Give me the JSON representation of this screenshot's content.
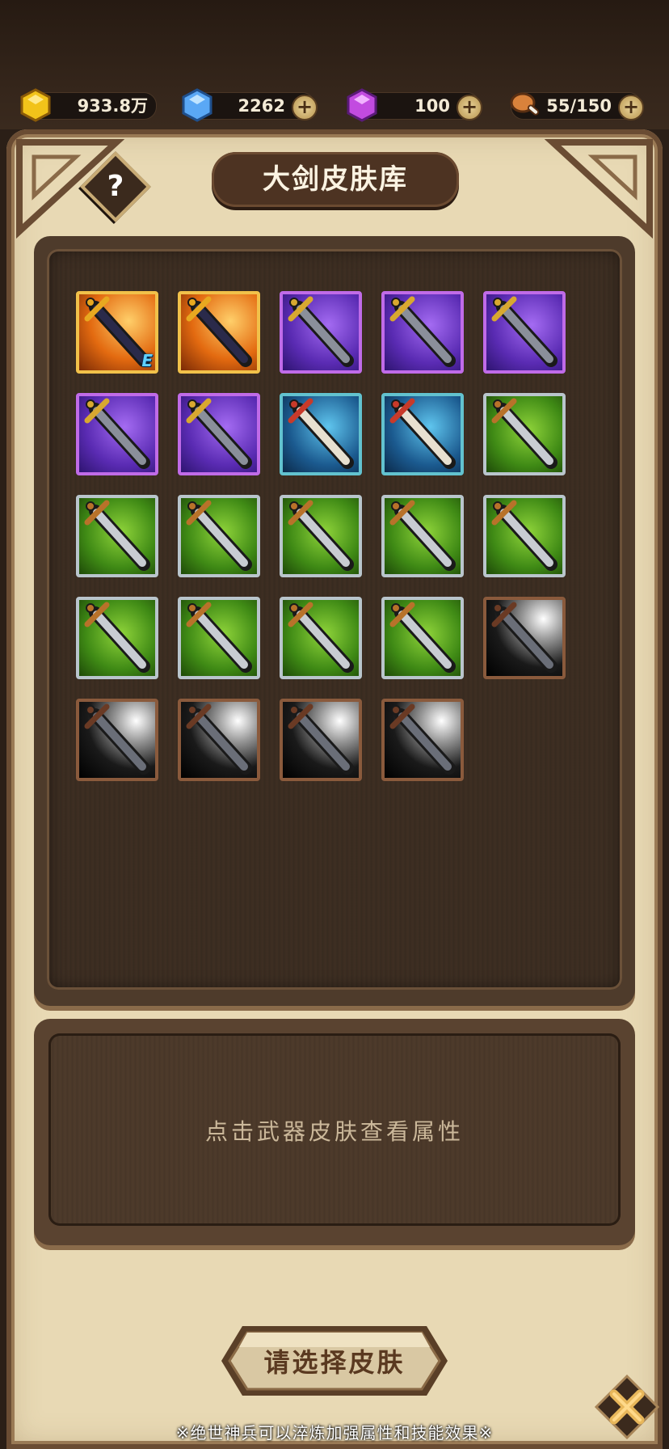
{
  "resources": {
    "gold": {
      "value": "933.8万",
      "icon": "gold-gem-icon",
      "color": "#f2c31a"
    },
    "diamond": {
      "value": "2262",
      "icon": "blue-diamond-icon",
      "color": "#5aa8f5",
      "plus": "+"
    },
    "crystal": {
      "value": "100",
      "icon": "purple-crystal-icon",
      "color": "#c24be0",
      "plus": "+"
    },
    "stamina": {
      "value": "55/150",
      "icon": "meat-drumstick-icon",
      "color": "#d9823b",
      "plus": "+"
    }
  },
  "header": {
    "title": "大剑皮肤库",
    "help_label": "?"
  },
  "skins": [
    {
      "rarity": "orange",
      "icon": "axe-greatsword-icon",
      "badge": "E"
    },
    {
      "rarity": "orange",
      "icon": "golden-greatsword-icon"
    },
    {
      "rarity": "purple",
      "icon": "dark-greatsword-icon"
    },
    {
      "rarity": "purple",
      "icon": "crimson-blade-icon"
    },
    {
      "rarity": "purple",
      "icon": "spiked-greatsword-icon"
    },
    {
      "rarity": "purple",
      "icon": "gold-hilt-sword-icon"
    },
    {
      "rarity": "purple",
      "icon": "bronze-hilt-sword-icon"
    },
    {
      "rarity": "blue",
      "icon": "bone-blade-icon"
    },
    {
      "rarity": "blue",
      "icon": "golden-cleaver-icon"
    },
    {
      "rarity": "green",
      "icon": "trident-hilt-sword-icon"
    },
    {
      "rarity": "green",
      "icon": "ornate-sword-icon"
    },
    {
      "rarity": "green",
      "icon": "steel-sword-icon"
    },
    {
      "rarity": "green",
      "icon": "ivory-sword-icon"
    },
    {
      "rarity": "green",
      "icon": "crescent-guard-sword-icon"
    },
    {
      "rarity": "green",
      "icon": "broad-sword-icon"
    },
    {
      "rarity": "green",
      "icon": "copper-sword-icon"
    },
    {
      "rarity": "green",
      "icon": "iron-sword-icon"
    },
    {
      "rarity": "green",
      "icon": "bell-guard-sword-icon"
    },
    {
      "rarity": "green",
      "icon": "ring-hilt-sword-icon"
    },
    {
      "rarity": "black",
      "icon": "thin-staff-icon"
    },
    {
      "rarity": "black",
      "icon": "wooden-sword-icon"
    },
    {
      "rarity": "black",
      "icon": "white-blade-icon"
    },
    {
      "rarity": "black",
      "icon": "grey-sword-icon"
    },
    {
      "rarity": "black",
      "icon": "plain-sword-icon"
    }
  ],
  "info": {
    "hint": "点击武器皮肤查看属性"
  },
  "actions": {
    "select_label": "请选择皮肤",
    "close_icon": "close-x-icon"
  },
  "footer": {
    "note": "※绝世神兵可以淬炼加强属性和技能效果※"
  }
}
